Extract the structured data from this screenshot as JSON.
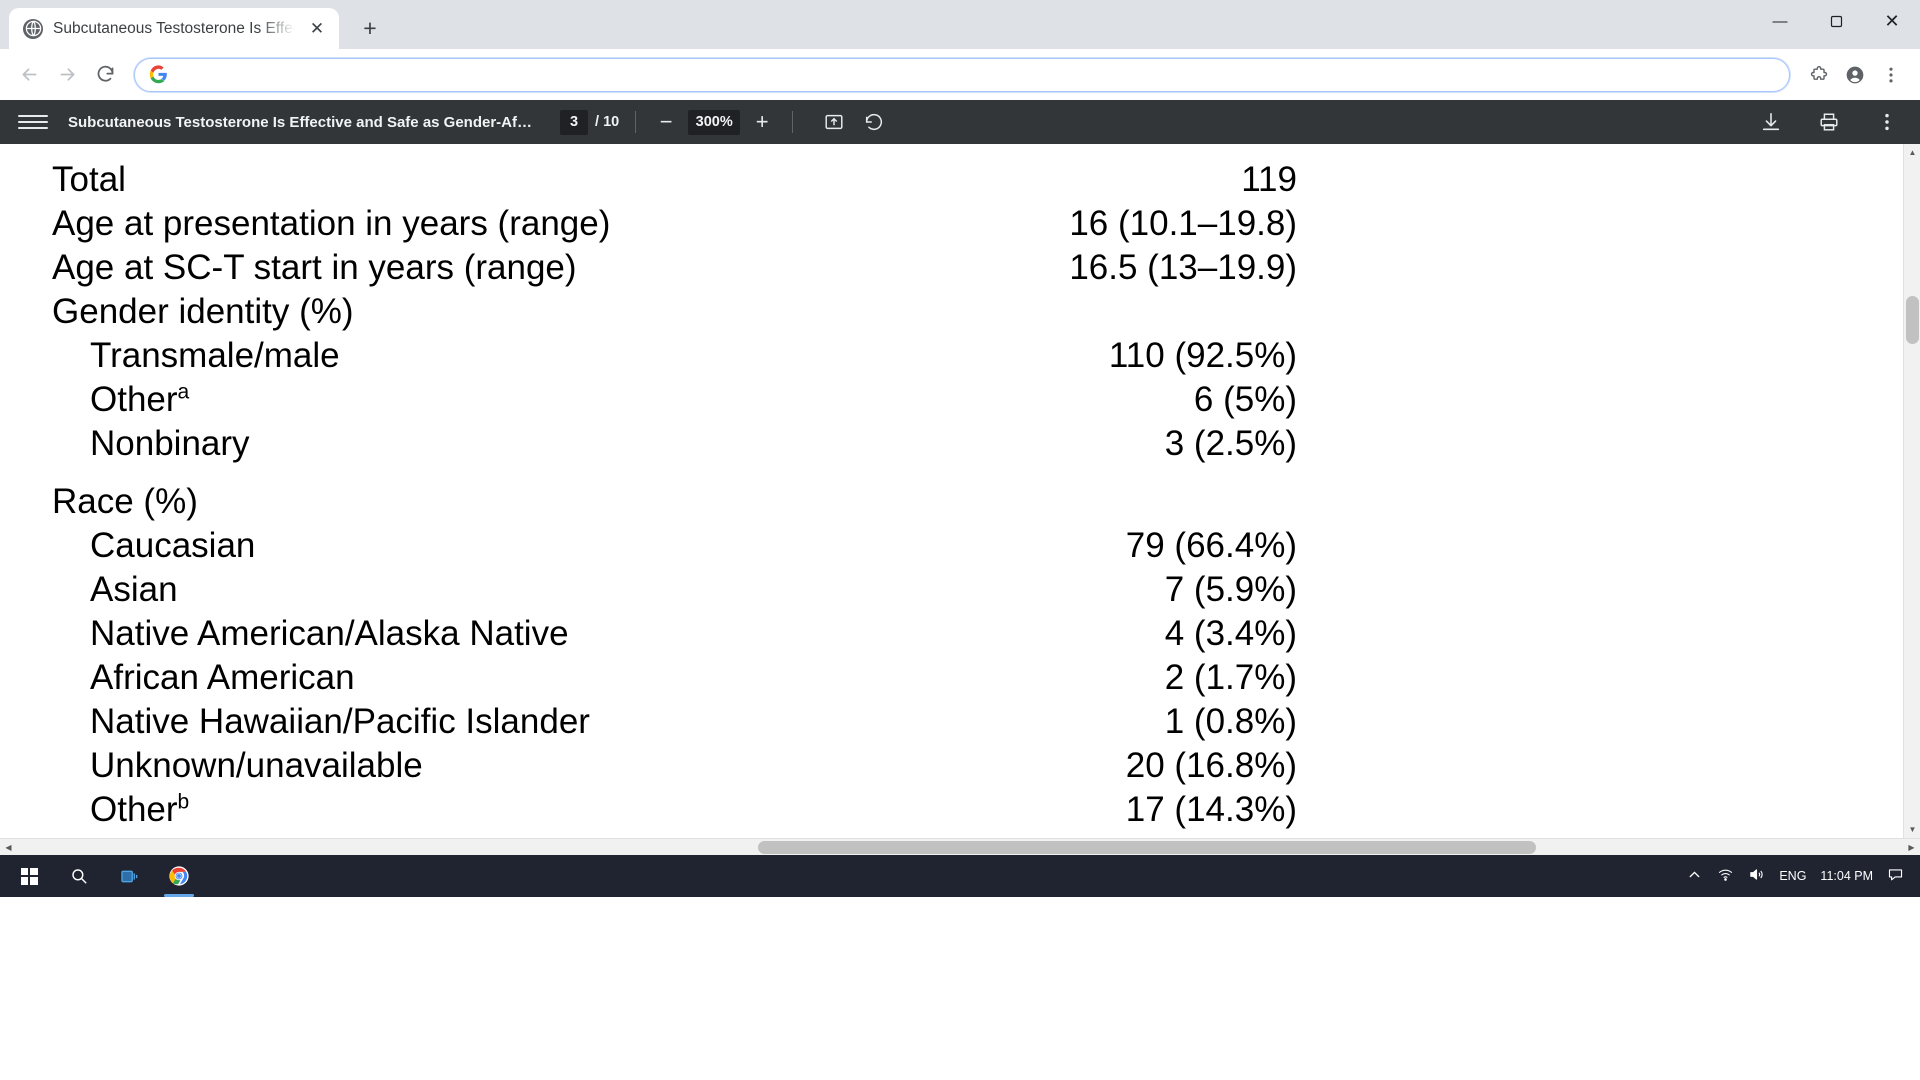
{
  "browser": {
    "tab": {
      "title": "Subcutaneous Testosterone Is Effective and Safe as Gender-Affirming Hormone Therapy",
      "favicon_icon": "globe-icon",
      "close_icon": "close-icon"
    },
    "new_tab_label": "+",
    "window_controls": {
      "minimize": "—",
      "maximize": "❐",
      "close": "✕"
    },
    "nav": {
      "back_icon": "arrow-left-icon",
      "forward_icon": "arrow-right-icon",
      "reload_icon": "reload-icon"
    },
    "omnibox": {
      "value": "",
      "placeholder": "",
      "leading_icon": "google-g-icon"
    },
    "toolbar_icons": {
      "extensions": "puzzle-piece-icon",
      "profile": "account-circle-icon",
      "menu": "three-dot-menu-icon"
    }
  },
  "pdf_viewer": {
    "menu_icon": "hamburger-menu-icon",
    "document_title": "Subcutaneous Testosterone Is Effective and Safe as Gender-Af…",
    "page_current": "3",
    "page_separator": "/ 10",
    "page_total": "10",
    "zoom_out_label": "−",
    "zoom_value": "300%",
    "zoom_in_label": "+",
    "fit_icon": "fit-to-page-icon",
    "rotate_icon": "rotate-icon",
    "download_icon": "download-icon",
    "print_icon": "print-icon",
    "more_icon": "three-dot-menu-icon"
  },
  "document": {
    "rows": [
      {
        "label": "Total",
        "value": "119",
        "indent": 0,
        "sup": ""
      },
      {
        "label": "Age at presentation in years (range)",
        "value": "16 (10.1–19.8)",
        "indent": 0,
        "sup": ""
      },
      {
        "label": "Age at SC-T start in years (range)",
        "value": "16.5 (13–19.9)",
        "indent": 0,
        "sup": ""
      },
      {
        "label": "Gender identity (%)",
        "value": "",
        "indent": 0,
        "sup": ""
      },
      {
        "label": "Transmale/male",
        "value": "110 (92.5%)",
        "indent": 1,
        "sup": ""
      },
      {
        "label": "Other",
        "value": "6 (5%)",
        "indent": 1,
        "sup": "a"
      },
      {
        "label": "Nonbinary",
        "value": "3 (2.5%)",
        "indent": 1,
        "sup": ""
      },
      {
        "label": "__GAP__",
        "value": "",
        "indent": 0,
        "sup": ""
      },
      {
        "label": "Race (%)",
        "value": "",
        "indent": 0,
        "sup": ""
      },
      {
        "label": "Caucasian",
        "value": "79 (66.4%)",
        "indent": 1,
        "sup": ""
      },
      {
        "label": "Asian",
        "value": "7 (5.9%)",
        "indent": 1,
        "sup": ""
      },
      {
        "label": "Native American/Alaska Native",
        "value": "4 (3.4%)",
        "indent": 1,
        "sup": ""
      },
      {
        "label": "African American",
        "value": "2 (1.7%)",
        "indent": 1,
        "sup": ""
      },
      {
        "label": "Native Hawaiian/Pacific Islander",
        "value": "1 (0.8%)",
        "indent": 1,
        "sup": ""
      },
      {
        "label": "Unknown/unavailable",
        "value": "20 (16.8%)",
        "indent": 1,
        "sup": ""
      },
      {
        "label": "Other",
        "value": "17 (14.3%)",
        "indent": 1,
        "sup": "b"
      }
    ]
  },
  "taskbar": {
    "start_icon": "windows-start-icon",
    "search_icon": "search-icon",
    "task_view_icon": "task-view-icon",
    "chrome_icon": "chrome-icon",
    "tray": {
      "chevron_icon": "chevron-up-icon",
      "network_icon": "wifi-icon",
      "volume_icon": "speaker-icon",
      "language": "ENG",
      "time": "11:04 PM",
      "notifications_icon": "notification-icon"
    }
  }
}
